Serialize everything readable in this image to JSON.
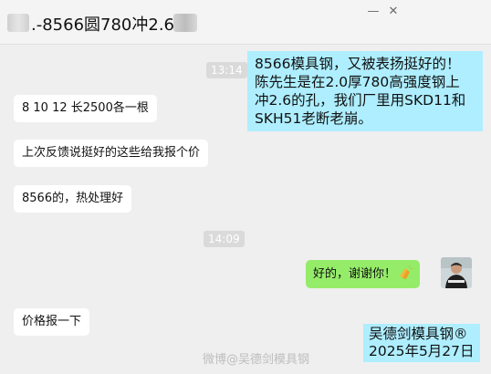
{
  "window": {
    "title": ".-8566圆780冲2.6孔",
    "minimize_glyph": "—",
    "close_glyph": "✕"
  },
  "messages": {
    "time1": "13:14",
    "time2": "14:09",
    "m1": "8 10 12  长2500各一根",
    "m2": "上次反馈说挺好的这些给我报个价",
    "m3": "8566的，热处理好",
    "m4": "好的，谢谢你！",
    "m5": "价格报一下"
  },
  "note": {
    "lines": [
      "8566模具钢，又被表扬挺好的！",
      "陈先生是在2.0厚780高强度钢上",
      "冲2.6的孔，我们厂里用SKD11和",
      "SKH51老断老崩。"
    ]
  },
  "signature": {
    "name": "吴德剑模具钢®",
    "date": "2025年5月27日"
  },
  "watermark": "微博@吴德剑模具钢",
  "colors": {
    "chat_bg": "#efefef",
    "my_bubble": "#95ec69",
    "note_bg": "#aeeeff"
  },
  "icons": {
    "emoji": "clapping-hands-icon",
    "avatar": "user-avatar"
  }
}
